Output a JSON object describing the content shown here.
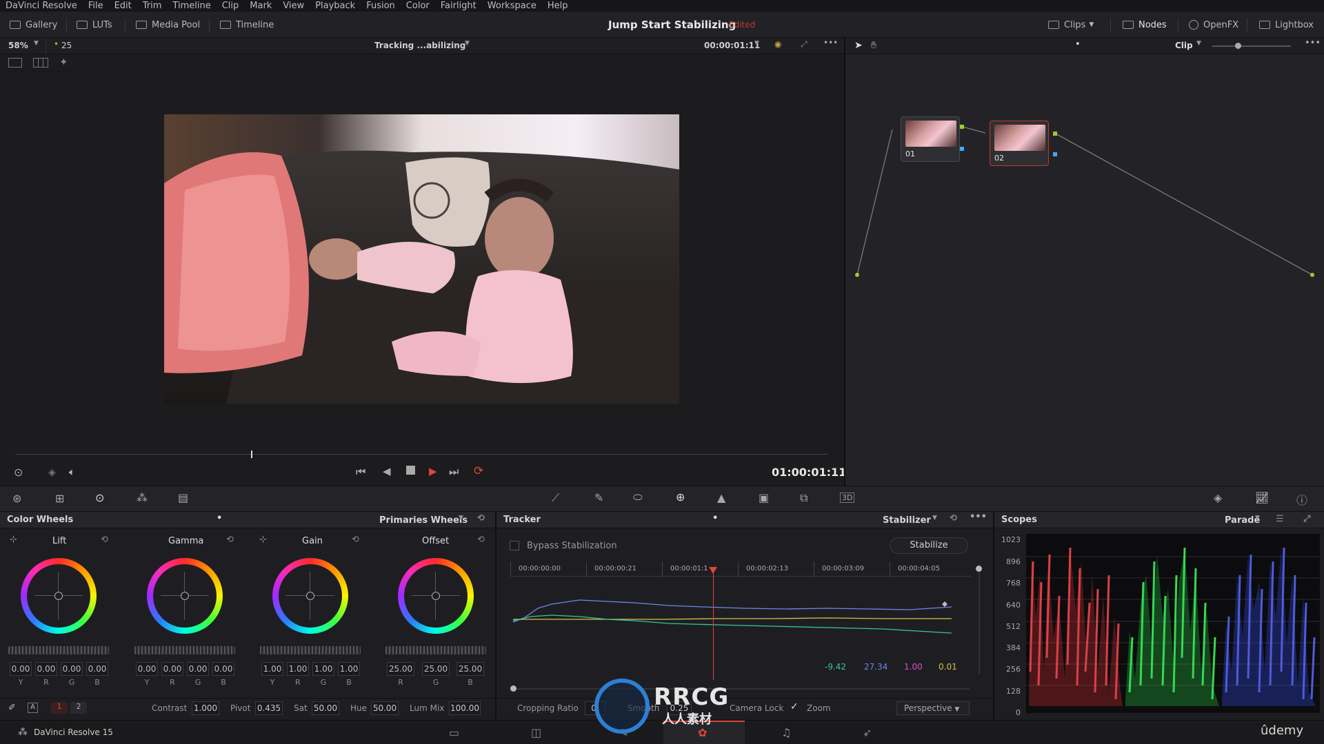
{
  "menu": [
    "DaVinci Resolve",
    "File",
    "Edit",
    "Trim",
    "Timeline",
    "Clip",
    "Mark",
    "View",
    "Playback",
    "Fusion",
    "Color",
    "Fairlight",
    "Workspace",
    "Help"
  ],
  "toolbar": {
    "gallery": "Gallery",
    "luts": "LUTs",
    "media_pool": "Media Pool",
    "timeline": "Timeline",
    "project_title": "Jump Start Stabilizing",
    "project_status": "Edited",
    "clips": "Clips",
    "nodes": "Nodes",
    "openfx": "OpenFX",
    "lightbox": "Lightbox"
  },
  "viewer": {
    "zoom": "58%",
    "frame_field": "25",
    "clip_name": "Tracking ...abilizing",
    "header_timecode": "00:00:01:11",
    "timecode": "01:00:01:11"
  },
  "nodes_panel": {
    "mode": "Clip",
    "node1_label": "01",
    "node2_label": "02"
  },
  "color_wheels": {
    "title": "Color Wheels",
    "mode": "Primaries Wheels",
    "wheels": [
      {
        "name": "Lift",
        "values": [
          "0.00",
          "0.00",
          "0.00",
          "0.00"
        ],
        "channels": [
          "Y",
          "R",
          "G",
          "B"
        ]
      },
      {
        "name": "Gamma",
        "values": [
          "0.00",
          "0.00",
          "0.00",
          "0.00"
        ],
        "channels": [
          "Y",
          "R",
          "G",
          "B"
        ]
      },
      {
        "name": "Gain",
        "values": [
          "1.00",
          "1.00",
          "1.00",
          "1.00"
        ],
        "channels": [
          "Y",
          "R",
          "G",
          "B"
        ]
      },
      {
        "name": "Offset",
        "values": [
          "25.00",
          "25.00",
          "25.00"
        ],
        "channels": [
          "R",
          "G",
          "B"
        ]
      }
    ],
    "page1": "1",
    "page2": "2",
    "contrast_label": "Contrast",
    "contrast": "1.000",
    "pivot_label": "Pivot",
    "pivot": "0.435",
    "sat_label": "Sat",
    "sat": "50.00",
    "hue_label": "Hue",
    "hue": "50.00",
    "lummix_label": "Lum Mix",
    "lummix": "100.00"
  },
  "tracker": {
    "title": "Tracker",
    "mode": "Stabilizer",
    "bypass": "Bypass Stabilization",
    "stabilize_btn": "Stabilize",
    "ruler": [
      "00:00:00:00",
      "00:00:00:21",
      "00:00:01:1",
      "00:00:02:13",
      "00:00:03:09",
      "00:00:04:05"
    ],
    "readouts": [
      "-9.42",
      "27.34",
      "1.00",
      "0.01"
    ],
    "cropping_label": "Cropping Ratio",
    "cropping_value": "0.",
    "smooth_label": "Smooth",
    "smooth_value": "0.25",
    "camera_lock": "Camera Lock",
    "zoom": "Zoom",
    "perspective": "Perspective",
    "colors": {
      "blue": "#6f86e6",
      "yellow": "#d4c24a",
      "green": "#35c7a0",
      "pink": "#e04ec9",
      "playhead": "#e0453c"
    }
  },
  "scopes": {
    "title": "Scopes",
    "mode": "Parade",
    "scale": [
      "1023",
      "896",
      "768",
      "640",
      "512",
      "384",
      "256",
      "128",
      "0"
    ]
  },
  "status": {
    "app": "DaVinci Resolve 15",
    "watermark": "RRCG",
    "watermark_sub": "人人素材",
    "brand": "ûdemy"
  }
}
